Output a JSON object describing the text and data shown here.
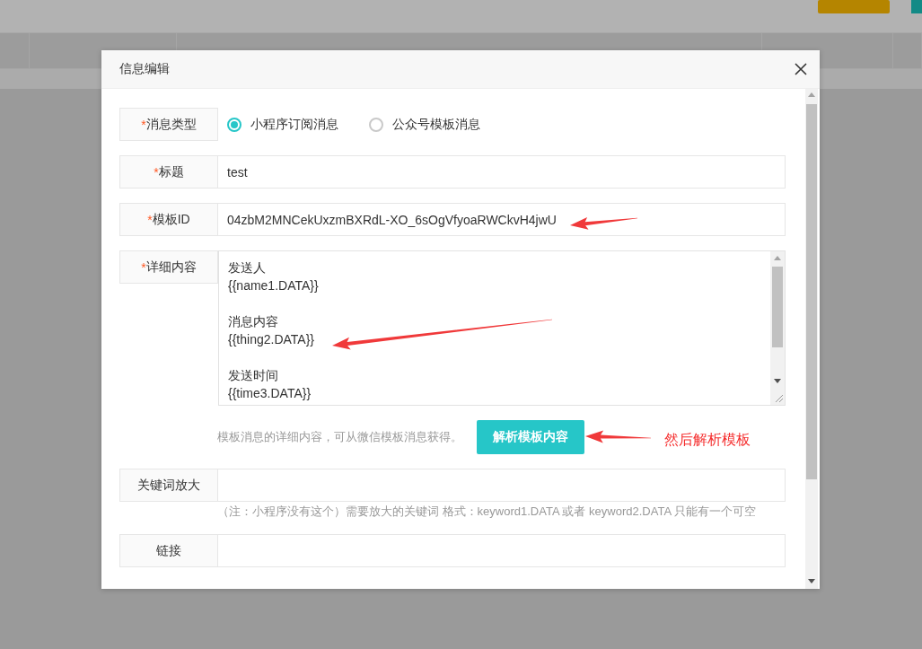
{
  "dialog": {
    "title": "信息编辑",
    "fields": [
      {
        "kind": "radio",
        "label": "消息类型",
        "mark": "*",
        "options": [
          {
            "label": "小程序订阅消息",
            "selected": true
          },
          {
            "label": "公众号模板消息",
            "selected": false
          }
        ]
      },
      {
        "kind": "input",
        "label": "标题",
        "mark": "*",
        "value": "test"
      },
      {
        "kind": "input",
        "label": "模板ID",
        "mark": "*",
        "value": "04zbM2MNCekUxzmBXRdL-XO_6sOgVfyoaRWCkvH4jwU"
      },
      {
        "kind": "textarea",
        "label": "详细内容",
        "mark": "*",
        "value": "发送人\n{{name1.DATA}}\n\n消息内容\n{{thing2.DATA}}\n\n发送时间\n{{time3.DATA}}",
        "hint": "模板消息的详细内容，可从微信模板消息获得。",
        "button": "解析模板内容"
      },
      {
        "kind": "input",
        "label": "关键词放大",
        "note": "（注：小程序没有这个）需要放大的关键词 格式：keyword1.DATA 或者 keyword2.DATA 只能有一个可空"
      },
      {
        "kind": "input",
        "label": "链接"
      }
    ]
  },
  "annotations": [
    {
      "kind": "arrow"
    },
    {
      "kind": "arrow"
    },
    {
      "kind": "arrow"
    },
    {
      "kind": "text",
      "text": "然后解析模板"
    }
  ]
}
